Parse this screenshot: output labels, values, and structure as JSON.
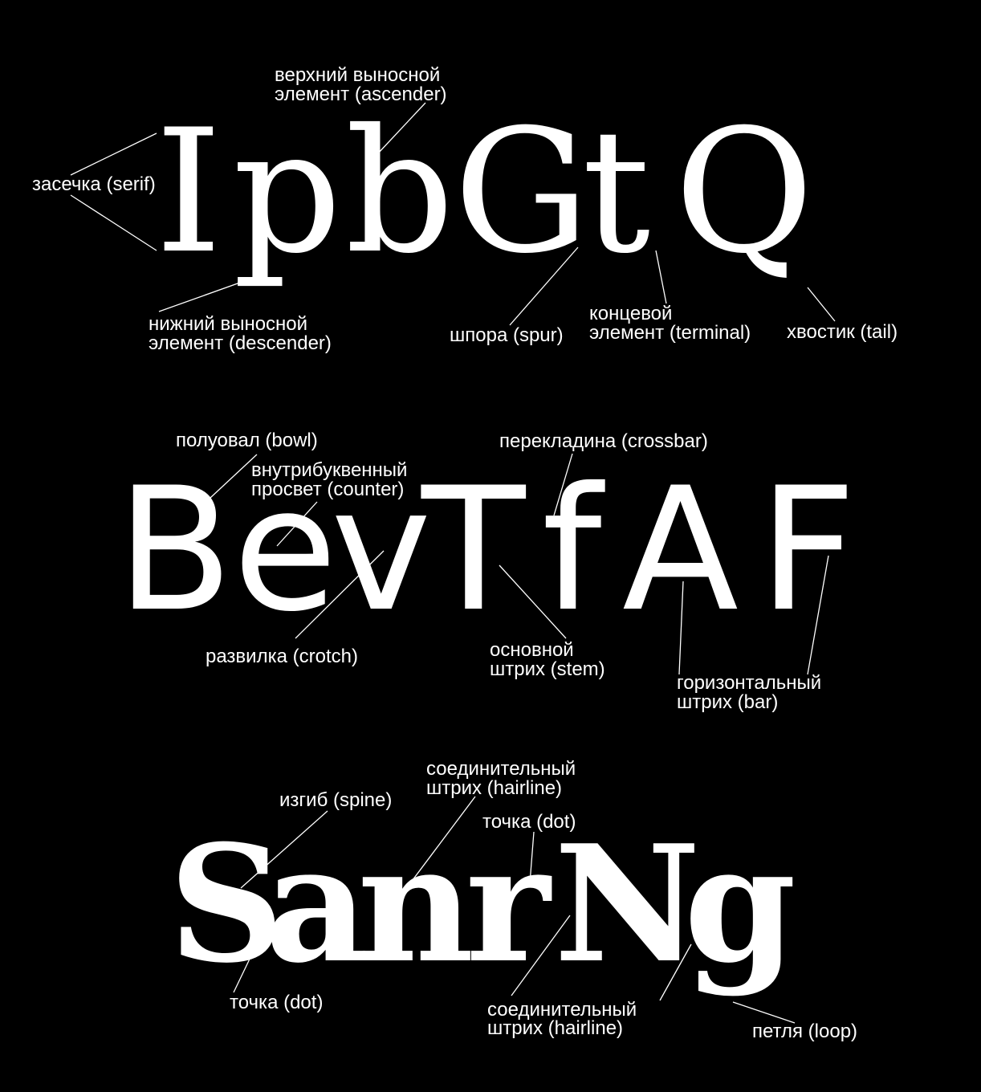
{
  "rows": [
    {
      "letters": [
        "I",
        "p",
        "b",
        "G",
        "t",
        "Q"
      ],
      "labels": {
        "ascender": [
          "верхний выносной",
          "элемент (ascender)"
        ],
        "serif": [
          "засечка (serif)"
        ],
        "descender": [
          "нижний выносной",
          "элемент (descender)"
        ],
        "spur": [
          "шпора (spur)"
        ],
        "terminal": [
          "концевой",
          "элемент (terminal)"
        ],
        "tail": [
          "хвостик (tail)"
        ]
      }
    },
    {
      "letters": [
        "B",
        "e",
        "v",
        "T",
        "f",
        "A",
        "F"
      ],
      "labels": {
        "bowl": [
          "полуовал (bowl)"
        ],
        "counter": [
          "внутрибуквенный",
          "просвет (counter)"
        ],
        "crossbar": [
          "перекладина (crossbar)"
        ],
        "crotch": [
          "развилка (crotch)"
        ],
        "stem": [
          "основной",
          "штрих (stem)"
        ],
        "bar": [
          "горизонтальный",
          "штрих (bar)"
        ]
      }
    },
    {
      "letters": [
        "S",
        "a",
        "n",
        "r",
        "N",
        "g"
      ],
      "labels": {
        "hairline_top": [
          "соединительный",
          "штрих (hairline)"
        ],
        "spine": [
          "изгиб (spine)"
        ],
        "dot_top": [
          "точка (dot)"
        ],
        "dot_bottom": [
          "точка (dot)"
        ],
        "hairline_bottom": [
          "соединительный",
          "штрих (hairline)"
        ],
        "loop": [
          "петля (loop)"
        ]
      }
    }
  ]
}
